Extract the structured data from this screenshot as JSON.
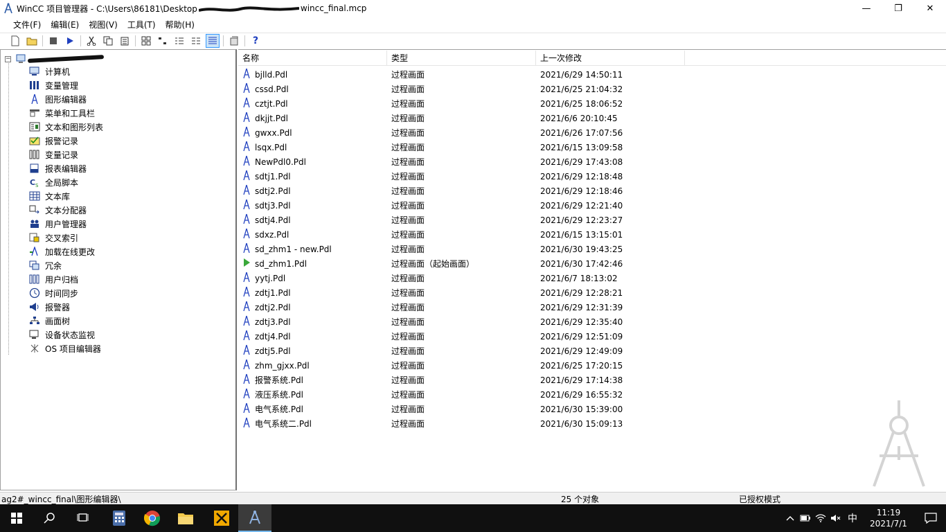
{
  "window": {
    "title": "WinCC 项目管理器 - C:\\Users\\86181\\Desktop",
    "title_tail": "wincc_final.mcp",
    "controls": [
      "—",
      "❐",
      "✕"
    ]
  },
  "menu": [
    "文件(F)",
    "编辑(E)",
    "视图(V)",
    "工具(T)",
    "帮助(H)"
  ],
  "tree": {
    "items": [
      {
        "label": "计算机",
        "icon": "computer-icon"
      },
      {
        "label": "变量管理",
        "icon": "tag-management-icon"
      },
      {
        "label": "图形编辑器",
        "icon": "graphics-designer-icon"
      },
      {
        "label": "菜单和工具栏",
        "icon": "menu-toolbar-icon"
      },
      {
        "label": "文本和图形列表",
        "icon": "text-graphic-list-icon"
      },
      {
        "label": "报警记录",
        "icon": "alarm-logging-icon"
      },
      {
        "label": "变量记录",
        "icon": "tag-logging-icon"
      },
      {
        "label": "报表编辑器",
        "icon": "report-designer-icon"
      },
      {
        "label": "全局脚本",
        "icon": "global-script-icon"
      },
      {
        "label": "文本库",
        "icon": "text-library-icon"
      },
      {
        "label": "文本分配器",
        "icon": "text-distributor-icon"
      },
      {
        "label": "用户管理器",
        "icon": "user-administrator-icon"
      },
      {
        "label": "交叉索引",
        "icon": "cross-reference-icon"
      },
      {
        "label": "加载在线更改",
        "icon": "load-online-changes-icon"
      },
      {
        "label": "冗余",
        "icon": "redundancy-icon"
      },
      {
        "label": "用户归档",
        "icon": "user-archive-icon"
      },
      {
        "label": "时间同步",
        "icon": "time-sync-icon"
      },
      {
        "label": "报警器",
        "icon": "horn-icon"
      },
      {
        "label": "画面树",
        "icon": "picture-tree-icon"
      },
      {
        "label": "设备状态监视",
        "icon": "device-monitor-icon"
      },
      {
        "label": "OS 项目编辑器",
        "icon": "os-project-editor-icon"
      }
    ]
  },
  "table": {
    "headers": [
      "名称",
      "类型",
      "上一次修改"
    ],
    "rows": [
      {
        "name": "bjlld.Pdl",
        "type": "过程画面",
        "modified": "2021/6/29 14:50:11",
        "start": false
      },
      {
        "name": "cssd.Pdl",
        "type": "过程画面",
        "modified": "2021/6/25 21:04:32",
        "start": false
      },
      {
        "name": "cztjt.Pdl",
        "type": "过程画面",
        "modified": "2021/6/25 18:06:52",
        "start": false
      },
      {
        "name": "dkjjt.Pdl",
        "type": "过程画面",
        "modified": "2021/6/6 20:10:45",
        "start": false
      },
      {
        "name": "gwxx.Pdl",
        "type": "过程画面",
        "modified": "2021/6/26 17:07:56",
        "start": false
      },
      {
        "name": "lsqx.Pdl",
        "type": "过程画面",
        "modified": "2021/6/15 13:09:58",
        "start": false
      },
      {
        "name": "NewPdl0.Pdl",
        "type": "过程画面",
        "modified": "2021/6/29 17:43:08",
        "start": false
      },
      {
        "name": "sdtj1.Pdl",
        "type": "过程画面",
        "modified": "2021/6/29 12:18:48",
        "start": false
      },
      {
        "name": "sdtj2.Pdl",
        "type": "过程画面",
        "modified": "2021/6/29 12:18:46",
        "start": false
      },
      {
        "name": "sdtj3.Pdl",
        "type": "过程画面",
        "modified": "2021/6/29 12:21:40",
        "start": false
      },
      {
        "name": "sdtj4.Pdl",
        "type": "过程画面",
        "modified": "2021/6/29 12:23:27",
        "start": false
      },
      {
        "name": "sdxz.Pdl",
        "type": "过程画面",
        "modified": "2021/6/15 13:15:01",
        "start": false
      },
      {
        "name": "sd_zhm1 - new.Pdl",
        "type": "过程画面",
        "modified": "2021/6/30 19:43:25",
        "start": false
      },
      {
        "name": "sd_zhm1.Pdl",
        "type": "过程画面（起始画面）",
        "modified": "2021/6/30 17:42:46",
        "start": true
      },
      {
        "name": "yytj.Pdl",
        "type": "过程画面",
        "modified": "2021/6/7 18:13:02",
        "start": false
      },
      {
        "name": "zdtj1.Pdl",
        "type": "过程画面",
        "modified": "2021/6/29 12:28:21",
        "start": false
      },
      {
        "name": "zdtj2.Pdl",
        "type": "过程画面",
        "modified": "2021/6/29 12:31:39",
        "start": false
      },
      {
        "name": "zdtj3.Pdl",
        "type": "过程画面",
        "modified": "2021/6/29 12:35:40",
        "start": false
      },
      {
        "name": "zdtj4.Pdl",
        "type": "过程画面",
        "modified": "2021/6/29 12:51:09",
        "start": false
      },
      {
        "name": "zdtj5.Pdl",
        "type": "过程画面",
        "modified": "2021/6/29 12:49:09",
        "start": false
      },
      {
        "name": "zhm_gjxx.Pdl",
        "type": "过程画面",
        "modified": "2021/6/25 17:20:15",
        "start": false
      },
      {
        "name": "报警系统.Pdl",
        "type": "过程画面",
        "modified": "2021/6/29 17:14:38",
        "start": false
      },
      {
        "name": "液压系统.Pdl",
        "type": "过程画面",
        "modified": "2021/6/29 16:55:32",
        "start": false
      },
      {
        "name": "电气系统.Pdl",
        "type": "过程画面",
        "modified": "2021/6/30 15:39:00",
        "start": false
      },
      {
        "name": "电气系统二.Pdl",
        "type": "过程画面",
        "modified": "2021/6/30 15:09:13",
        "start": false
      }
    ]
  },
  "status": {
    "path": "ag2#_wincc_final\\图形编辑器\\",
    "count": "25 个对象",
    "license": "已授权模式"
  },
  "taskbar": {
    "time": "11:19",
    "date": "2021/7/1",
    "ime": "中",
    "accent": "#76b9ed"
  }
}
